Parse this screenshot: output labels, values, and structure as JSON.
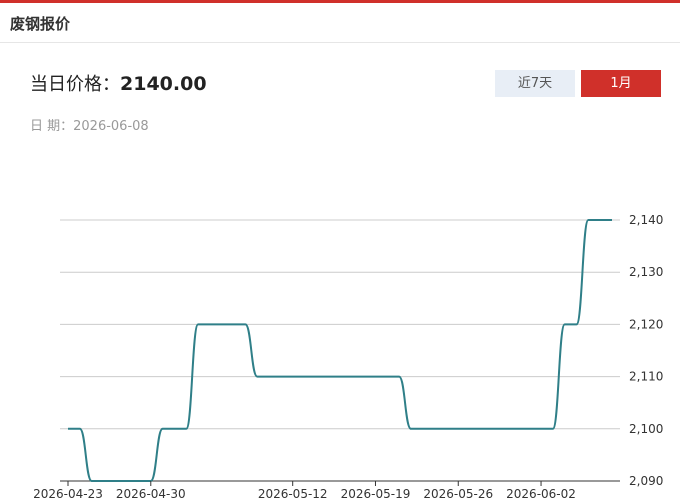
{
  "header": {
    "title": "废钢报价"
  },
  "price": {
    "label": "当日价格：",
    "value": "2140.00"
  },
  "date": {
    "label": "日 期：",
    "value": "2026-06-08"
  },
  "tabs": [
    {
      "label": "近7天",
      "active": false
    },
    {
      "label": "1月",
      "active": true
    }
  ],
  "colors": {
    "accent": "#d0302a",
    "line": "#2f7f88",
    "grid": "#cccccc",
    "inactive_tab": "#e8eef6"
  },
  "chart_data": {
    "type": "line",
    "x": [
      "2026-04-23",
      "2026-04-24",
      "2026-04-25",
      "2026-04-26",
      "2026-04-27",
      "2026-04-28",
      "2026-04-29",
      "2026-04-30",
      "2026-05-01",
      "2026-05-02",
      "2026-05-03",
      "2026-05-04",
      "2026-05-05",
      "2026-05-06",
      "2026-05-07",
      "2026-05-08",
      "2026-05-09",
      "2026-05-10",
      "2026-05-11",
      "2026-05-12",
      "2026-05-13",
      "2026-05-14",
      "2026-05-15",
      "2026-05-16",
      "2026-05-17",
      "2026-05-18",
      "2026-05-19",
      "2026-05-20",
      "2026-05-21",
      "2026-05-22",
      "2026-05-23",
      "2026-05-24",
      "2026-05-25",
      "2026-05-26",
      "2026-05-27",
      "2026-05-28",
      "2026-05-29",
      "2026-05-30",
      "2026-05-31",
      "2026-06-01",
      "2026-06-02",
      "2026-06-03",
      "2026-06-04",
      "2026-06-05",
      "2026-06-06",
      "2026-06-07",
      "2026-06-08"
    ],
    "series": [
      {
        "values": [
          2100,
          2100,
          2090,
          2090,
          2090,
          2090,
          2090,
          2090,
          2100,
          2100,
          2100,
          2120,
          2120,
          2120,
          2120,
          2120,
          2110,
          2110,
          2110,
          2110,
          2110,
          2110,
          2110,
          2110,
          2110,
          2110,
          2110,
          2110,
          2110,
          2100,
          2100,
          2100,
          2100,
          2100,
          2100,
          2100,
          2100,
          2100,
          2100,
          2100,
          2100,
          2100,
          2120,
          2120,
          2140,
          2140,
          2140
        ]
      }
    ],
    "x_tick_labels": [
      "2026-04-23",
      "2026-04-30",
      "2026-05-12",
      "2026-05-19",
      "2026-05-26",
      "2026-06-02"
    ],
    "y_ticks": [
      "2,090",
      "2,100",
      "2,110",
      "2,120",
      "2,130",
      "2,140"
    ],
    "ylim": [
      2090,
      2140
    ],
    "grid": true,
    "legend": "none"
  }
}
